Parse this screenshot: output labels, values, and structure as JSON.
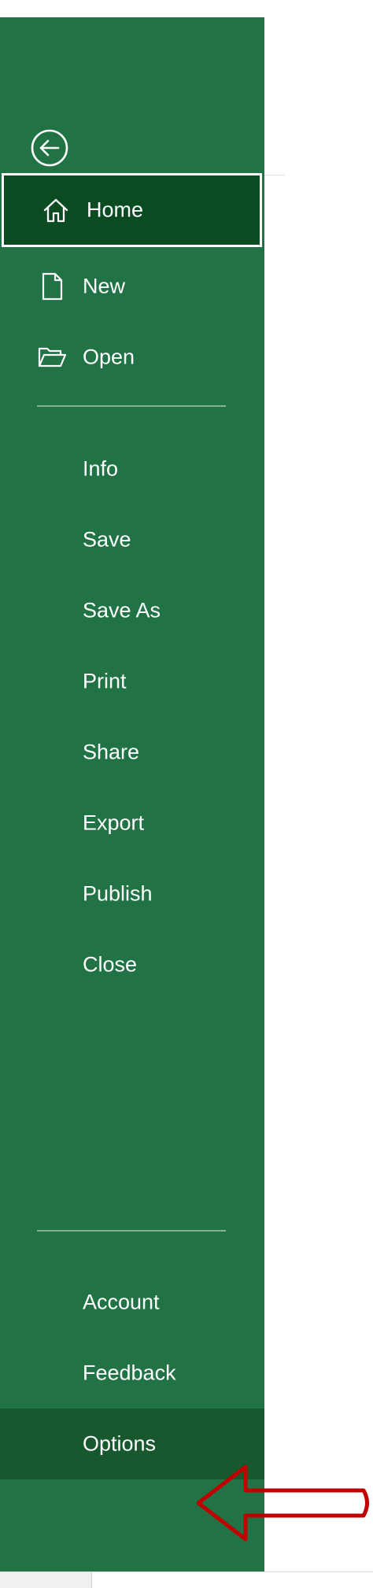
{
  "backstage": {
    "back_button": {
      "icon": "back-arrow-circle-icon"
    },
    "nav_items": [
      {
        "id": "home",
        "label": "Home",
        "icon": "home-icon",
        "selected": true
      },
      {
        "id": "new",
        "label": "New",
        "icon": "new-document-icon"
      },
      {
        "id": "open",
        "label": "Open",
        "icon": "open-folder-icon"
      },
      {
        "id": "info",
        "label": "Info"
      },
      {
        "id": "save",
        "label": "Save"
      },
      {
        "id": "save-as",
        "label": "Save As"
      },
      {
        "id": "print",
        "label": "Print"
      },
      {
        "id": "share",
        "label": "Share"
      },
      {
        "id": "export",
        "label": "Export"
      },
      {
        "id": "publish",
        "label": "Publish"
      },
      {
        "id": "close",
        "label": "Close"
      },
      {
        "id": "account",
        "label": "Account"
      },
      {
        "id": "feedback",
        "label": "Feedback"
      },
      {
        "id": "options",
        "label": "Options",
        "highlighted": true
      }
    ]
  },
  "colors": {
    "backstage_green": "#217346",
    "selected_green": "#0a4b22",
    "highlight_green": "#18582f",
    "annotation_red": "#c00000"
  },
  "annotation": {
    "type": "arrow",
    "points_to": "options",
    "icon": "red-outline-arrow"
  }
}
